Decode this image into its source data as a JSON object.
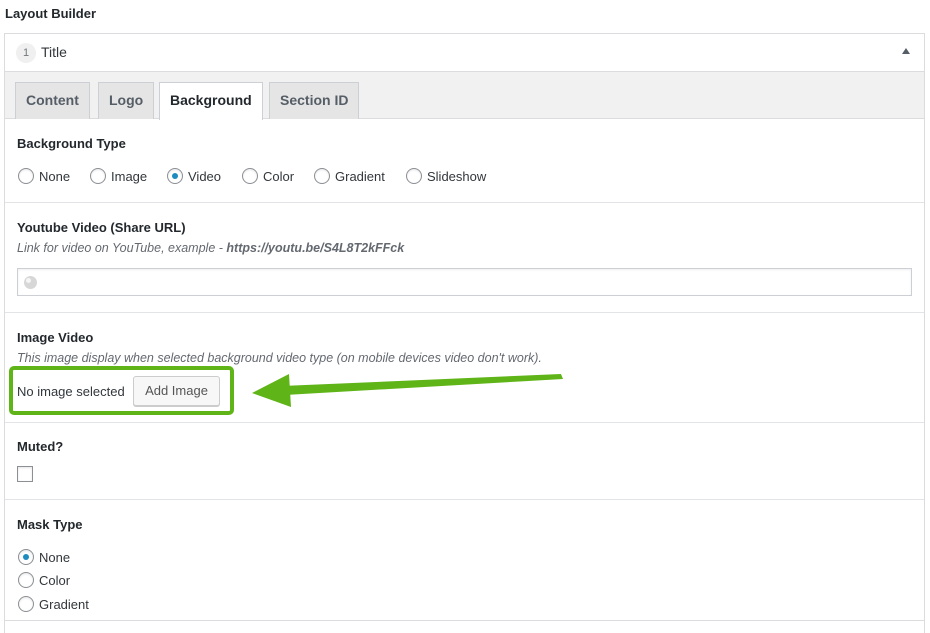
{
  "page": {
    "heading": "Layout Builder"
  },
  "section": {
    "number": "1",
    "title": "Title"
  },
  "tabs": [
    {
      "label": "Content",
      "active": false
    },
    {
      "label": "Logo",
      "active": false
    },
    {
      "label": "Background",
      "active": true
    },
    {
      "label": "Section ID",
      "active": false
    }
  ],
  "background_type": {
    "label": "Background Type",
    "options": [
      "None",
      "Image",
      "Video",
      "Color",
      "Gradient",
      "Slideshow"
    ],
    "selected": "Video"
  },
  "youtube": {
    "label": "Youtube Video (Share URL)",
    "desc_prefix": "Link for video on YouTube, example - ",
    "desc_example": "https://youtu.be/S4L8T2kFFck",
    "value": ""
  },
  "image_video": {
    "label": "Image Video",
    "description": "This image display when selected background video type (on mobile devices video don't work).",
    "status": "No image selected",
    "button": "Add Image"
  },
  "muted": {
    "label": "Muted?",
    "checked": false
  },
  "mask_type": {
    "label": "Mask Type",
    "options": [
      "None",
      "Color",
      "Gradient"
    ],
    "selected": "None"
  },
  "colors": {
    "highlight": "#5fb417",
    "radio_accent": "#1e8cbe"
  },
  "icons": {
    "url_field": "globe-icon",
    "collapse": "triangle-up-icon"
  }
}
